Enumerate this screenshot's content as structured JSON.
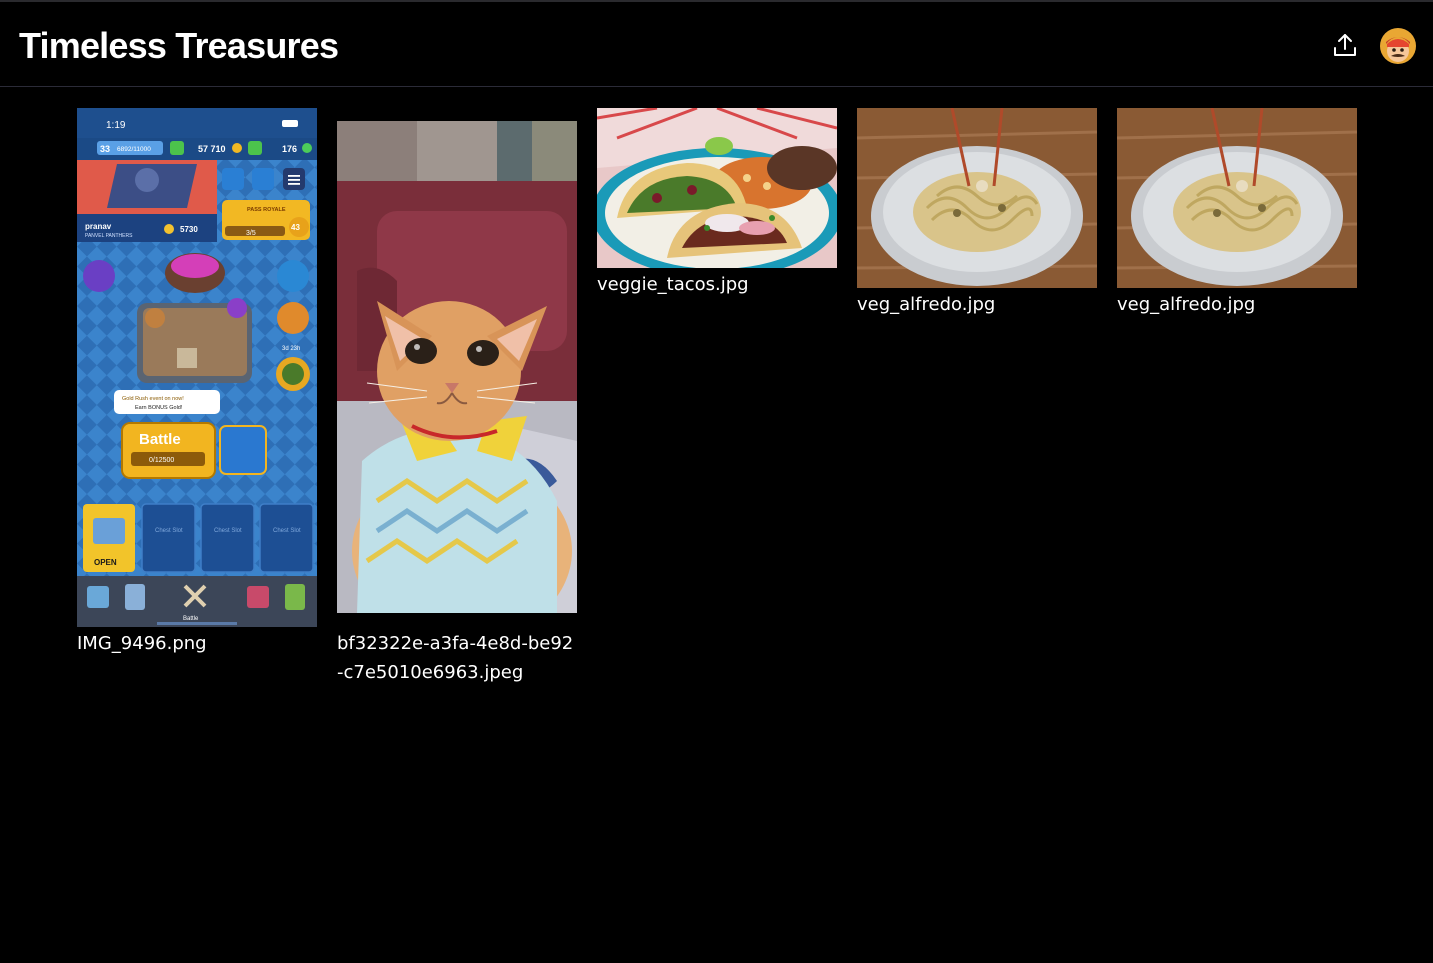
{
  "header": {
    "title": "Timeless Treasures",
    "upload_icon": "upload-icon",
    "avatar_icon": "avatar-icon"
  },
  "gallery": {
    "items": [
      {
        "filename": "IMG_9496.png",
        "thumbnail": "mobile-game-screenshot"
      },
      {
        "filename": "bf32322e-a3fa-4e8d-be92-c7e5010e6963.jpeg",
        "thumbnail": "cat-photo"
      },
      {
        "filename": "veggie_tacos.jpg",
        "thumbnail": "tacos-photo"
      },
      {
        "filename": "veg_alfredo.jpg",
        "thumbnail": "pasta-photo"
      },
      {
        "filename": "veg_alfredo.jpg",
        "thumbnail": "pasta-photo"
      }
    ]
  },
  "game_screenshot": {
    "time": "1:19",
    "level": "33",
    "xp": "6892/11000",
    "gold": "57 710",
    "gems": "176",
    "player_name": "pranav",
    "clan_name": "PANVEL PANTHERS",
    "trophies": "5730",
    "pass_label": "PASS ROYALE",
    "pass_progress": "3/5",
    "pass_level": "43",
    "timer": "3d 23h",
    "event_text_1": "Gold Rush event on now!",
    "event_text_2": "Earn BONUS Gold!",
    "battle_label": "Battle",
    "battle_progress": "0/12500",
    "open_label": "OPEN",
    "chest_slot_label": "Chest Slot",
    "nav_battle_label": "Battle"
  },
  "colors": {
    "background": "#000000",
    "header_border": "#2b2b38",
    "text": "#ffffff"
  }
}
